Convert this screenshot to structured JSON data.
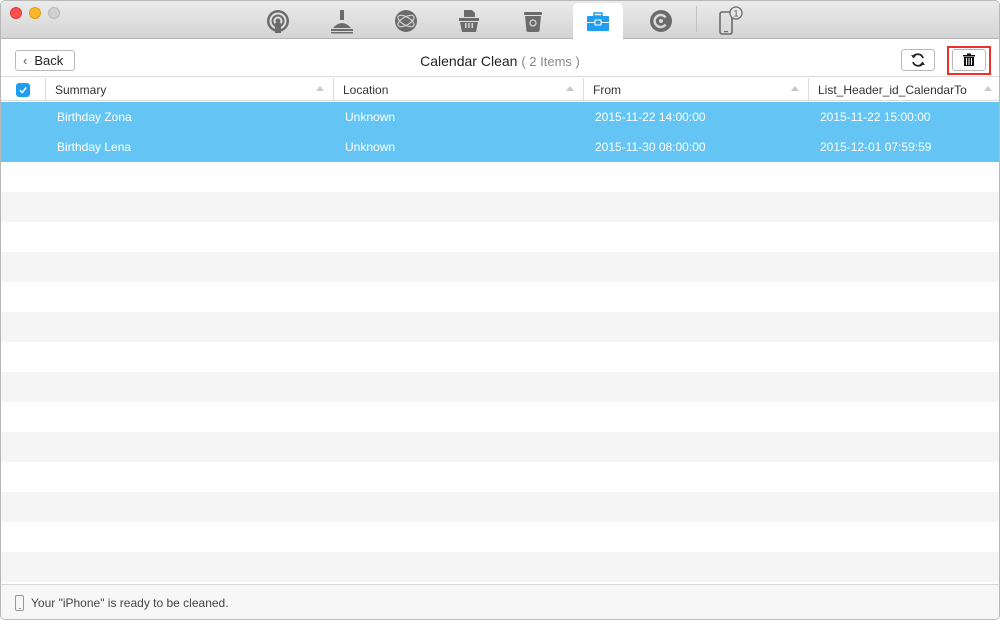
{
  "window": {
    "controls": [
      "close",
      "minimize",
      "maximize"
    ]
  },
  "toolbar": {
    "tabs": [
      {
        "icon": "airplay-icon",
        "active": false
      },
      {
        "icon": "broom-icon",
        "active": false
      },
      {
        "icon": "globe-icon",
        "active": false
      },
      {
        "icon": "shredder-basket-icon",
        "active": false
      },
      {
        "icon": "recycle-bin-icon",
        "active": false
      },
      {
        "icon": "toolbox-icon",
        "active": true
      },
      {
        "icon": "clean-c-icon",
        "active": false
      },
      {
        "icon": "iphone-device-icon",
        "active": false,
        "badge": "1"
      }
    ],
    "accent_color": "#1e9ef0"
  },
  "header": {
    "back_label": "Back",
    "title": "Calendar Clean",
    "count": "( 2 Items )",
    "refresh_icon": "refresh-icon",
    "delete_icon": "trash-icon",
    "delete_highlight_color": "#e8322a"
  },
  "table": {
    "columns": [
      "Summary",
      "Location",
      "From",
      "List_Header_id_CalendarTo"
    ],
    "select_all": true,
    "rows": [
      {
        "checked": true,
        "summary": "Birthday Zona",
        "location": "Unknown",
        "from": "2015-11-22 14:00:00",
        "to": "2015-11-22 15:00:00"
      },
      {
        "checked": true,
        "summary": "Birthday Lena",
        "location": "Unknown",
        "from": "2015-11-30 08:00:00",
        "to": "2015-12-01 07:59:59"
      }
    ],
    "selected_row_color": "#64c5f5"
  },
  "status": {
    "message": "Your \"iPhone\" is ready to be cleaned."
  }
}
